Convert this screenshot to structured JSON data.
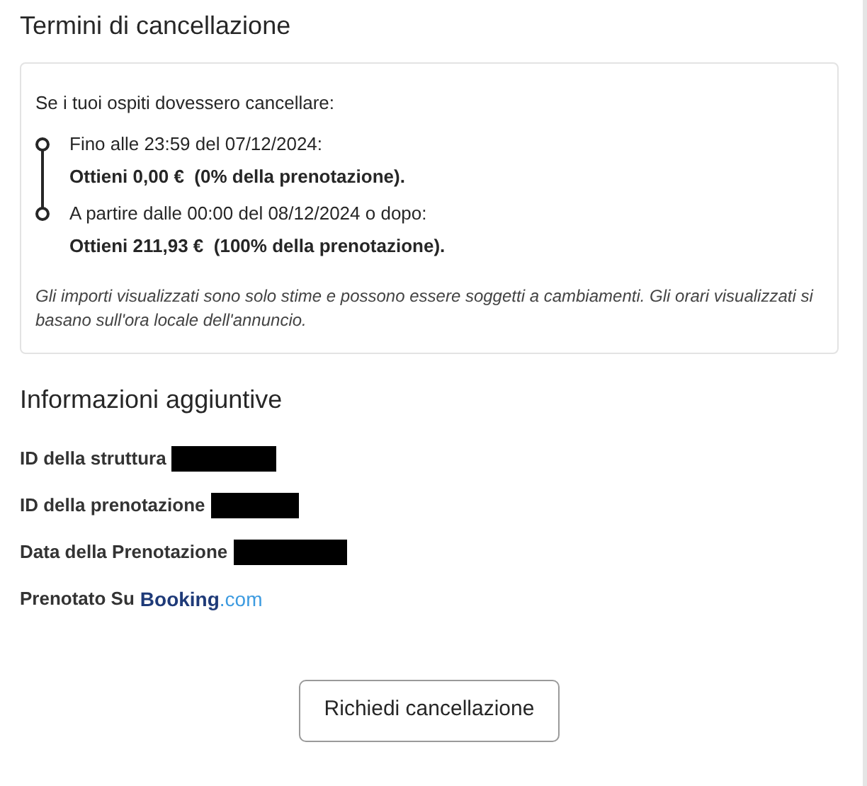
{
  "cancellation": {
    "title": "Termini di cancellazione",
    "intro": "Se i tuoi ospiti dovessero cancellare:",
    "timeline": [
      {
        "when": "Fino alle 23:59 del 07/12/2024:",
        "refund": "Ottieni 0,00 €  (0% della prenotazione)."
      },
      {
        "when": "A partire dalle 00:00 del 08/12/2024 o dopo:",
        "refund": "Ottieni 211,93 €  (100% della prenotazione)."
      }
    ],
    "note": "Gli importi visualizzati sono solo stime e possono essere soggetti a cambiamenti. Gli orari visualizzati si basano sull'ora locale dell'annuncio."
  },
  "additional_info": {
    "title": "Informazioni aggiuntive",
    "fields": [
      {
        "label": "ID della struttura",
        "kind": "redacted"
      },
      {
        "label": "ID della prenotazione",
        "kind": "redacted"
      },
      {
        "label": "Data della Prenotazione",
        "kind": "redacted"
      },
      {
        "label": "Prenotato Su",
        "kind": "logo",
        "logo": {
          "name": "Booking",
          "suffix": ".com"
        }
      }
    ]
  },
  "button": "Richiedi cancellazione"
}
